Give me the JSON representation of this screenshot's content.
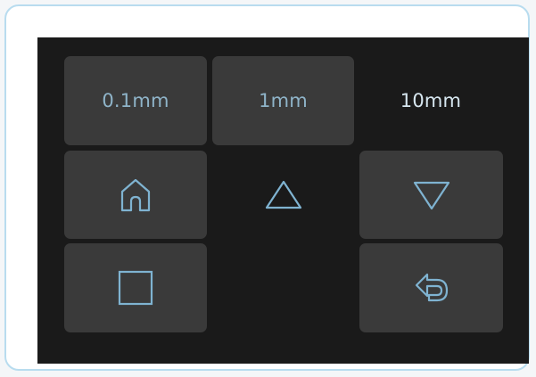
{
  "step_options": [
    "0.1mm",
    "1mm",
    "10mm"
  ],
  "selected_step": "10mm",
  "icons": {
    "home": "home-icon",
    "up": "triangle-up-icon",
    "down": "triangle-down-icon",
    "stop": "square-icon",
    "back": "return-icon"
  },
  "colors": {
    "screen_bg": "#1a1a1a",
    "button_bg": "#3a3a3a",
    "icon_stroke": "#7fb3d1",
    "device_border": "#b8dcef"
  }
}
